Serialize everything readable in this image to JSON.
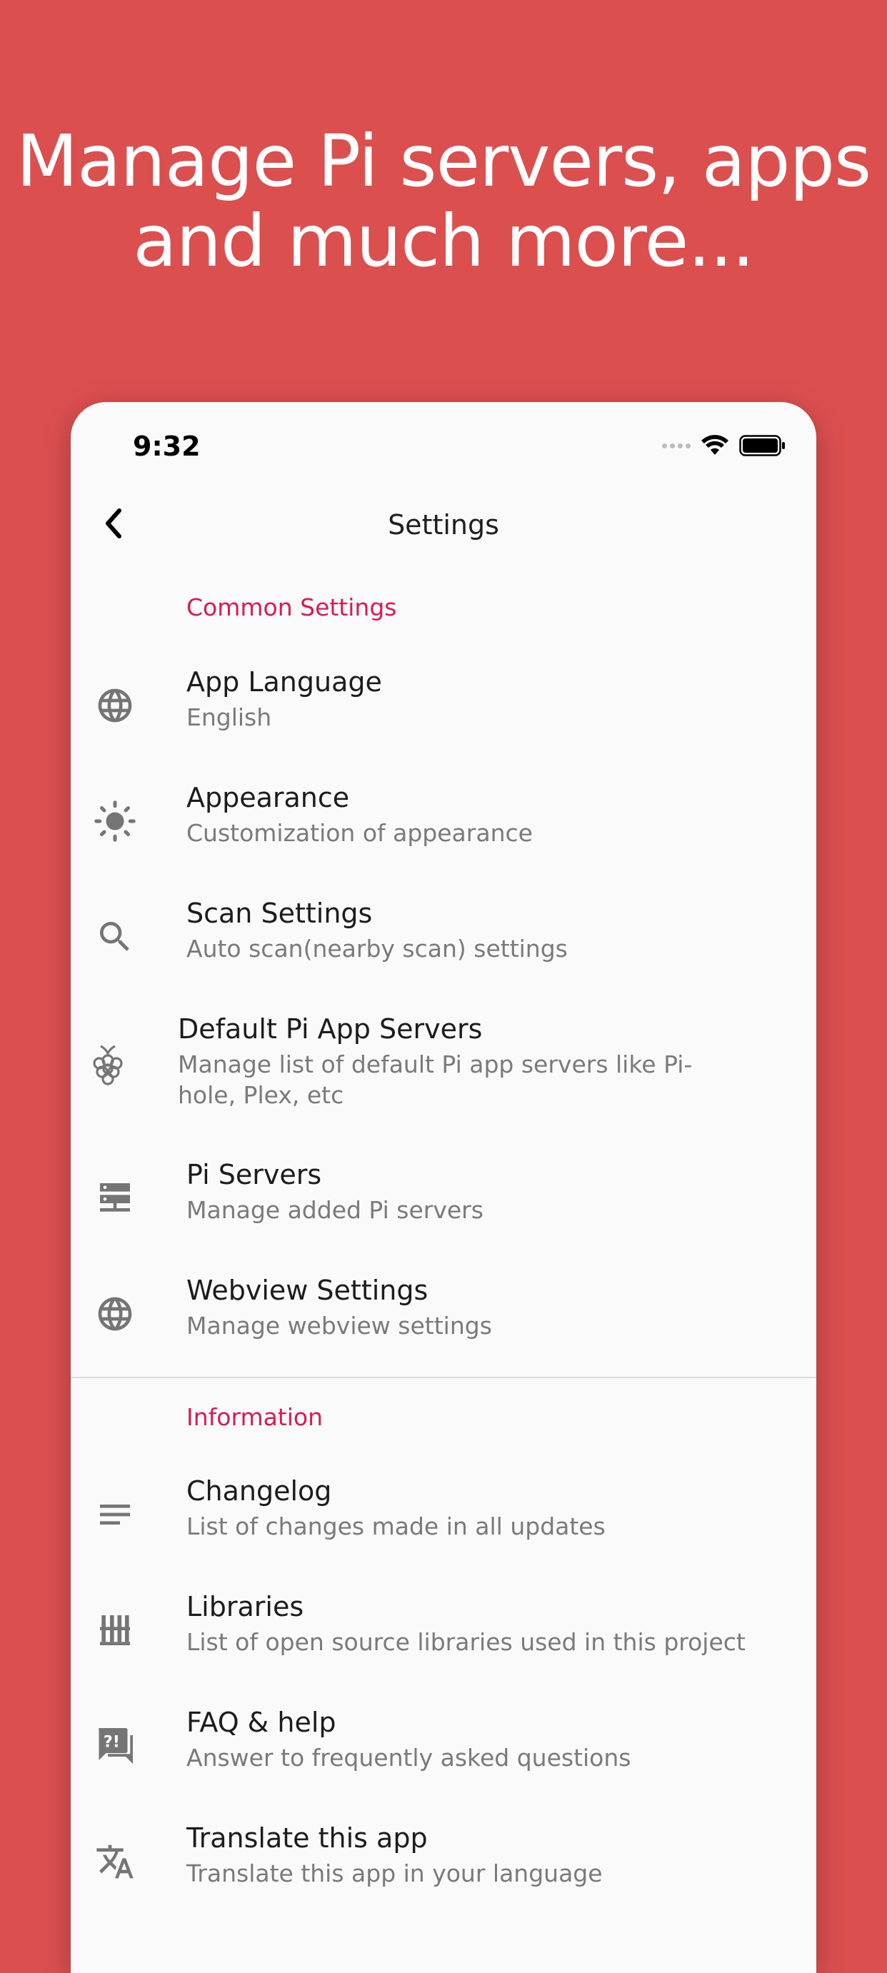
{
  "headline": {
    "line1": "Manage Pi servers, apps",
    "line2": "and much more..."
  },
  "status_bar": {
    "time": "9:32"
  },
  "app_bar": {
    "title": "Settings"
  },
  "sections": {
    "common": "Common Settings",
    "information": "Information"
  },
  "items": {
    "language": {
      "title": "App Language",
      "subtitle": "English",
      "icon": "globe-icon"
    },
    "appearance": {
      "title": "Appearance",
      "subtitle": "Customization of appearance",
      "icon": "brightness-icon"
    },
    "scan": {
      "title": "Scan Settings",
      "subtitle": "Auto scan(nearby scan) settings",
      "icon": "search-icon"
    },
    "default_servers": {
      "title": "Default Pi App Servers",
      "subtitle": "Manage list of default Pi app servers like Pi-hole, Plex, etc",
      "icon": "raspberry-icon"
    },
    "pi_servers": {
      "title": "Pi Servers",
      "subtitle": "Manage added Pi servers",
      "icon": "server-icon"
    },
    "webview": {
      "title": "Webview Settings",
      "subtitle": "Manage webview settings",
      "icon": "globe-icon"
    },
    "changelog": {
      "title": "Changelog",
      "subtitle": "List of changes made in all updates",
      "icon": "notes-icon"
    },
    "libraries": {
      "title": "Libraries",
      "subtitle": "List of open source libraries used in this project",
      "icon": "library-icon"
    },
    "faq": {
      "title": "FAQ & help",
      "subtitle": "Answer to frequently asked questions",
      "icon": "faq-icon"
    },
    "translate": {
      "title": "Translate this app",
      "subtitle": "Translate this app in your language",
      "icon": "translate-icon"
    }
  },
  "colors": {
    "background": "#DC4F4F",
    "accent": "#D81B50",
    "surface": "#FAFAFA"
  }
}
